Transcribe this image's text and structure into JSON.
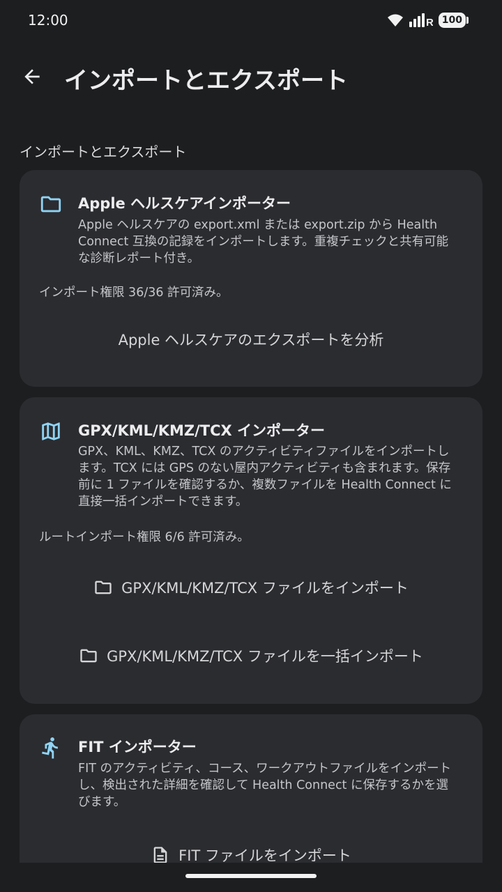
{
  "status_bar": {
    "time": "12:00",
    "battery": "100",
    "network_letter": "R"
  },
  "app_bar": {
    "title": "インポートとエクスポート"
  },
  "section": {
    "heading": "インポートとエクスポート"
  },
  "cards": [
    {
      "icon": "folder-icon",
      "title": "Apple ヘルスケアインポーター",
      "description_lines": [
        "Apple ヘルスケアの export.xml または export.zip から Health",
        "Connect 互換の記録をインポートします。重複チェックと共有可能",
        "な診断レポート付き。"
      ],
      "status": "インポート権限 36/36 許可済み。",
      "buttons": [
        {
          "label": "Apple ヘルスケアのエクスポートを分析"
        }
      ]
    },
    {
      "icon": "map-icon",
      "title": "GPX/KML/KMZ/TCX インポーター",
      "description_lines": [
        "GPX、KML、KMZ、TCX のアクティビティファイルをインポートし",
        "ます。TCX には GPS のない屋内アクティビティも含まれます。保存",
        "前に 1 ファイルを確認するか、複数ファイルを Health Connect に",
        "直接一括インポートできます。"
      ],
      "status": "ルートインポート権限 6/6 許可済み。",
      "buttons": [
        {
          "label": "GPX/KML/KMZ/TCX ファイルをインポート",
          "icon": "folder-icon"
        },
        {
          "label": "GPX/KML/KMZ/TCX ファイルを一括インポート",
          "icon": "folder-icon"
        }
      ]
    },
    {
      "icon": "running-icon",
      "title": "FIT インポーター",
      "description_lines": [
        "FIT のアクティビティ、コース、ワークアウトファイルをインポート",
        "し、検出された詳細を確認して Health Connect に保存するかを選",
        "びます。"
      ],
      "buttons": [
        {
          "label": "FIT ファイルをインポート",
          "icon": "document-icon"
        }
      ]
    }
  ],
  "colors": {
    "background": "#1d1e20",
    "card": "#2b2c30",
    "accent_icon": "#8fd3f4"
  }
}
